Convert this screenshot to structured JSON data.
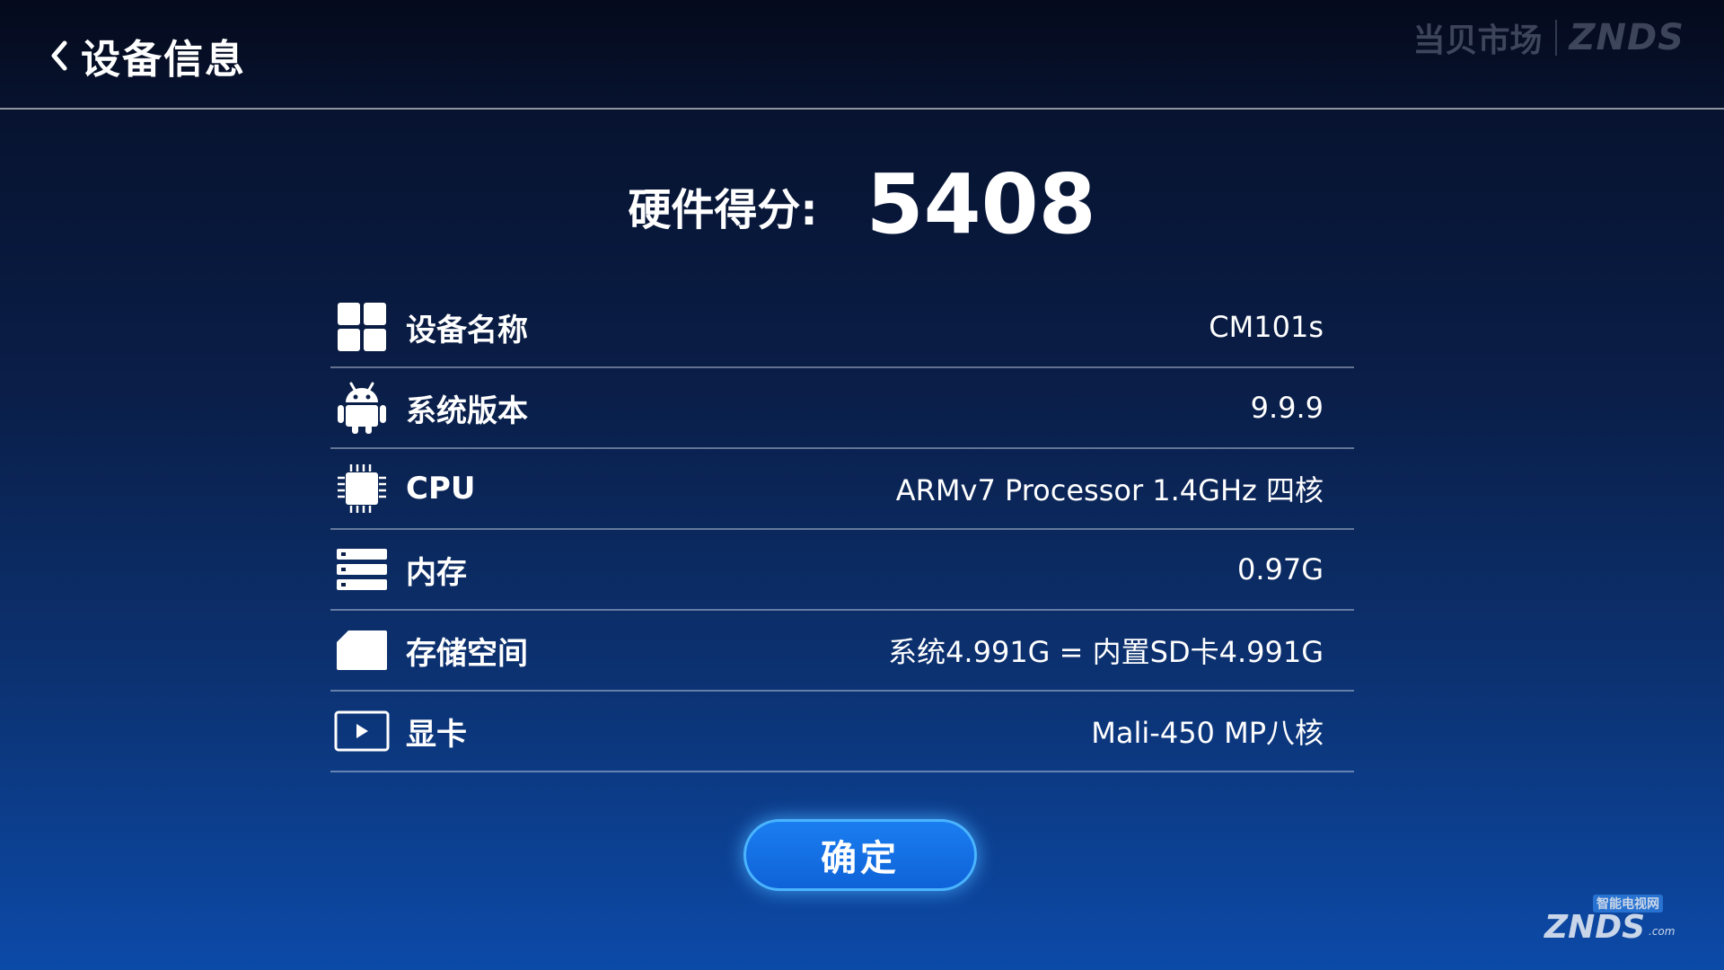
{
  "header": {
    "title": "设备信息",
    "brand_cn": "当贝市场",
    "brand_en": "ZNDS"
  },
  "score": {
    "label": "硬件得分:",
    "value": "5408"
  },
  "items": [
    {
      "icon": "grid-icon",
      "label": "设备名称",
      "value": "CM101s"
    },
    {
      "icon": "android-icon",
      "label": "系统版本",
      "value": "9.9.9"
    },
    {
      "icon": "cpu-chip-icon",
      "label": "CPU",
      "value": "ARMv7 Processor 1.4GHz 四核"
    },
    {
      "icon": "memory-icon",
      "label": "内存",
      "value": "0.97G"
    },
    {
      "icon": "sd-card-icon",
      "label": "存储空间",
      "value": "系统4.991G = 内置SD卡4.991G"
    },
    {
      "icon": "play-screen-icon",
      "label": "显卡",
      "value": "Mali-450 MP八核"
    }
  ],
  "confirm_label": "确定",
  "watermark": {
    "cn": "智能电视网",
    "en": "ZNDS",
    "suffix": ".com"
  },
  "colors": {
    "background_top": "#050a1c",
    "background_bottom": "#0c4aa8",
    "button": "#1470e6",
    "button_glow": "#4ab4ff"
  }
}
